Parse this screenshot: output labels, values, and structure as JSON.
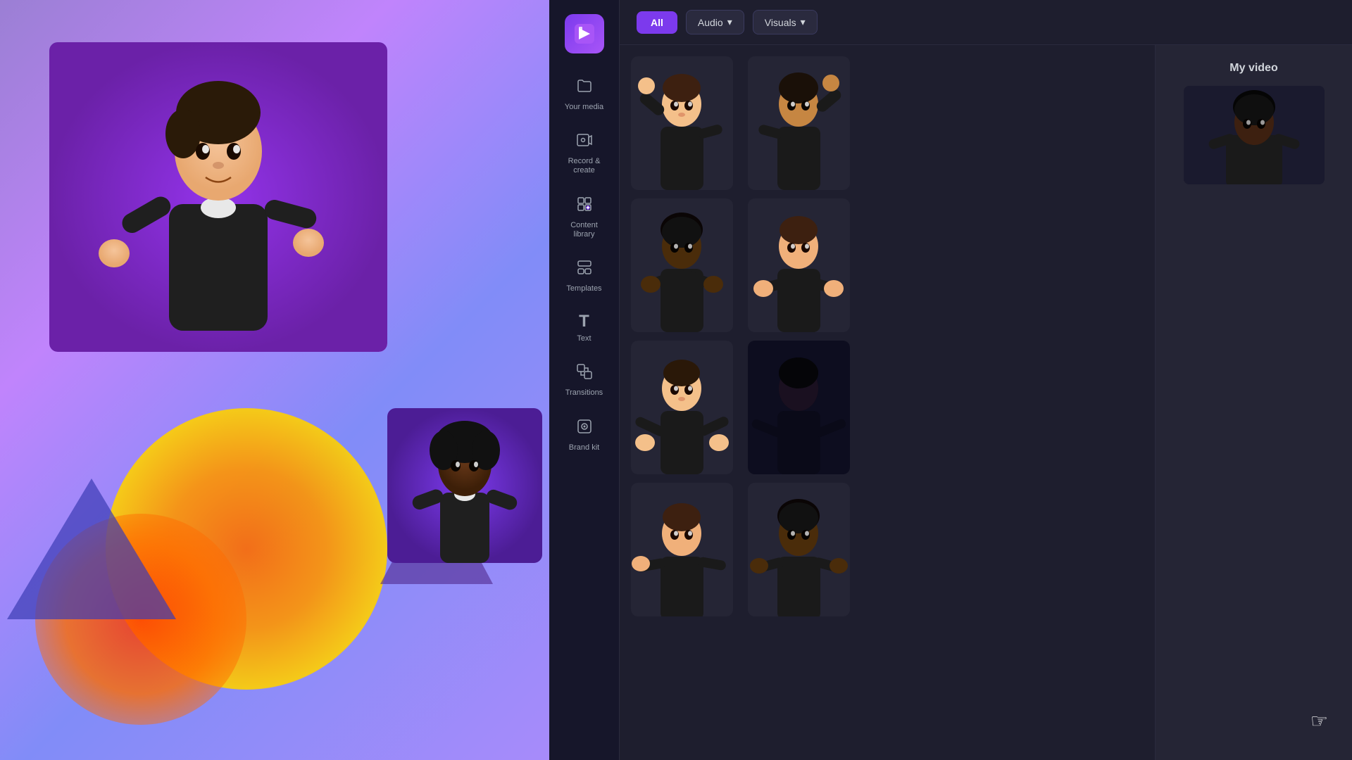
{
  "canvas": {
    "presenter_main_bg": "linear-gradient(160deg, #6b46c1, #a855f7)",
    "presenter_small_bg": "linear-gradient(160deg, #7c3aed, #5b21b6)"
  },
  "topbar": {
    "filter_all": "All",
    "filter_audio": "Audio",
    "filter_visuals": "Visuals",
    "my_video_title": "My video"
  },
  "sidebar": {
    "logo_icon": "◈",
    "items": [
      {
        "id": "your-media",
        "icon": "🗁",
        "label": "Your media"
      },
      {
        "id": "record-create",
        "icon": "⊡",
        "label": "Record &\ncreate"
      },
      {
        "id": "content-library",
        "icon": "⊞",
        "label": "Content\nlibrary"
      },
      {
        "id": "templates",
        "icon": "⊟",
        "label": "Templates"
      },
      {
        "id": "text",
        "icon": "T",
        "label": "Text"
      },
      {
        "id": "transitions",
        "icon": "⊠",
        "label": "Transitions"
      },
      {
        "id": "brand-kit",
        "icon": "◈",
        "label": "Brand kit"
      }
    ]
  },
  "avatars": [
    {
      "id": 1,
      "skin": "light",
      "hair": "brown",
      "pose": "point-up"
    },
    {
      "id": 2,
      "skin": "medium",
      "hair": "dark",
      "pose": "point-up-alt"
    },
    {
      "id": 3,
      "skin": "dark",
      "hair": "black",
      "pose": "arms-cross"
    },
    {
      "id": 4,
      "skin": "light",
      "hair": "brown",
      "pose": "arms-cross-alt"
    },
    {
      "id": 5,
      "skin": "light",
      "hair": "dark",
      "pose": "arms-low"
    },
    {
      "id": 6,
      "skin": "medium",
      "hair": "black",
      "pose": "arms-low-alt"
    },
    {
      "id": 7,
      "skin": "light",
      "hair": "brown",
      "pose": "gesture"
    },
    {
      "id": 8,
      "skin": "dark",
      "hair": "black",
      "pose": "gesture-alt"
    }
  ]
}
